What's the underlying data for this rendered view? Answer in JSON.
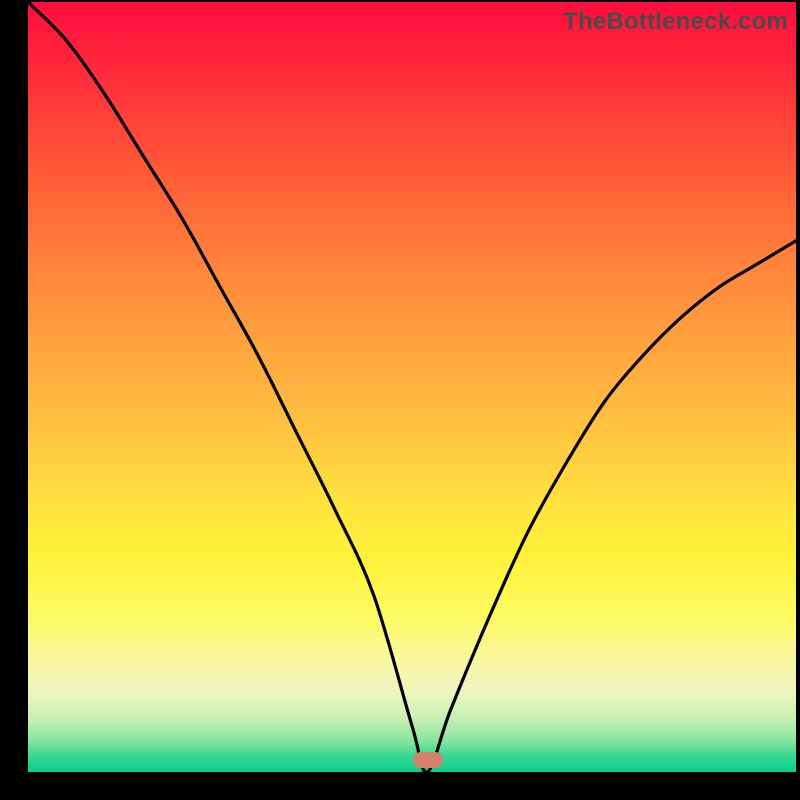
{
  "watermark": "TheBottleneck.com",
  "colors": {
    "frame_bg": "#000000",
    "curve_stroke": "#000000",
    "marker_fill": "#d57f6c"
  },
  "marker": {
    "x_frac": 0.521,
    "y_frac": 0.985
  },
  "chart_data": {
    "type": "line",
    "title": "",
    "xlabel": "",
    "ylabel": "",
    "xlim": [
      0,
      100
    ],
    "ylim": [
      0,
      100
    ],
    "legend": false,
    "grid": false,
    "background": "vertical-gradient red→yellow→green",
    "series": [
      {
        "name": "bottleneck-curve",
        "x": [
          0,
          5,
          10,
          15,
          20,
          25,
          30,
          35,
          40,
          45,
          50,
          52,
          55,
          60,
          65,
          70,
          75,
          80,
          85,
          90,
          95,
          100
        ],
        "y": [
          100,
          95,
          88,
          80,
          72,
          63,
          54,
          44,
          34,
          23,
          6,
          0,
          8,
          20,
          31,
          40,
          48,
          54,
          59,
          63,
          66,
          69
        ]
      }
    ],
    "annotations": [
      {
        "type": "marker",
        "x": 52,
        "y": 0,
        "shape": "pill",
        "color": "#d57f6c"
      }
    ],
    "note": "Curve reaches minimum (0) near x≈52; left branch starts at top-left corner, right branch rises to ≈69% height at right edge. Values estimated from pixel positions."
  }
}
